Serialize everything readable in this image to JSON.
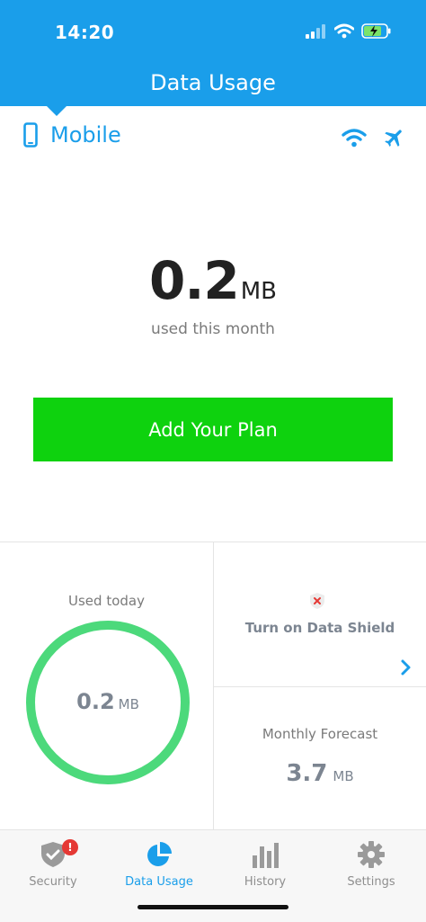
{
  "status_bar": {
    "time": "14:20"
  },
  "header": {
    "title": "Data Usage"
  },
  "mode": {
    "label": "Mobile"
  },
  "usage": {
    "value": "0.2",
    "unit": "MB",
    "caption": "used this month"
  },
  "plan_button": {
    "label": "Add Your Plan"
  },
  "today": {
    "label": "Used today",
    "value": "0.2",
    "unit": "MB"
  },
  "shield": {
    "label": "Turn on Data Shield"
  },
  "forecast": {
    "label": "Monthly Forecast",
    "value": "3.7",
    "unit": "MB"
  },
  "tabs": [
    {
      "label": "Security",
      "icon": "shield-check-icon",
      "badge": "!"
    },
    {
      "label": "Data Usage",
      "icon": "pie-chart-icon",
      "active": true
    },
    {
      "label": "History",
      "icon": "bar-chart-icon"
    },
    {
      "label": "Settings",
      "icon": "gear-icon"
    }
  ],
  "colors": {
    "accent": "#1a9eea",
    "plan_button": "#0ed20e",
    "ring": "#4cd97b",
    "badge": "#e53935"
  }
}
